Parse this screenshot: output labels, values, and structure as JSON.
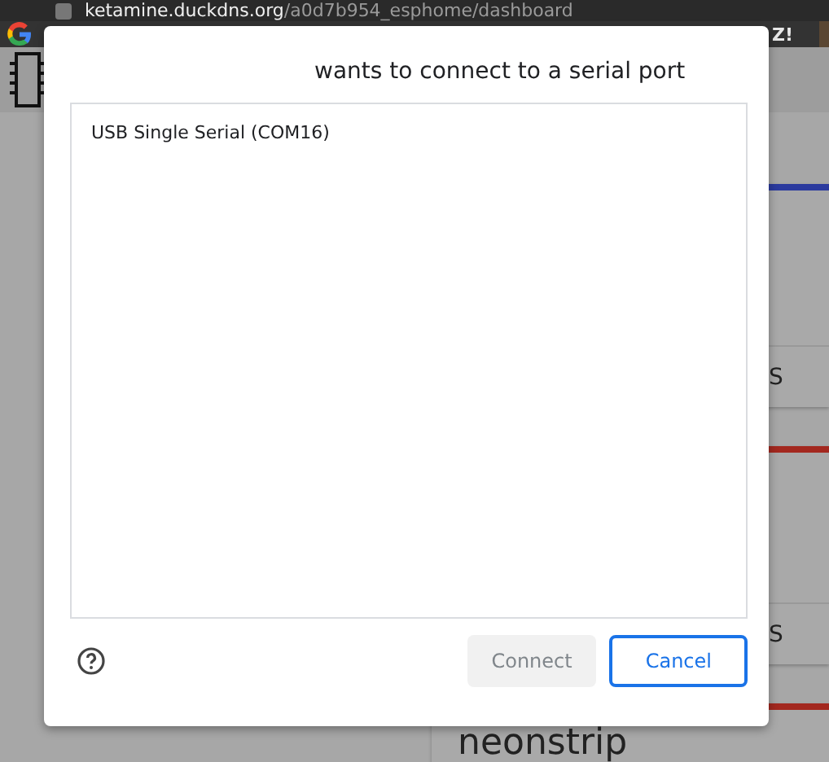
{
  "browser": {
    "url_host": "ketamine.duckdns.org",
    "url_path": "/a0d7b954_esphome/dashboard",
    "bookmarks": [
      {
        "label": "Z!"
      }
    ]
  },
  "page": {
    "cards": [
      {
        "color": "#2b3a9e",
        "action": "S"
      },
      {
        "color": "#a3281f",
        "action": "S"
      },
      {
        "color": "#a3281f",
        "title": "neonstrip"
      }
    ]
  },
  "dialog": {
    "title": "wants to connect to a serial port",
    "ports": [
      {
        "label": "USB Single Serial (COM16)",
        "selected": false
      }
    ],
    "buttons": [
      {
        "label": "Connect",
        "kind": "primary",
        "disabled": true
      },
      {
        "label": "Cancel",
        "kind": "secondary",
        "disabled": false
      }
    ]
  }
}
